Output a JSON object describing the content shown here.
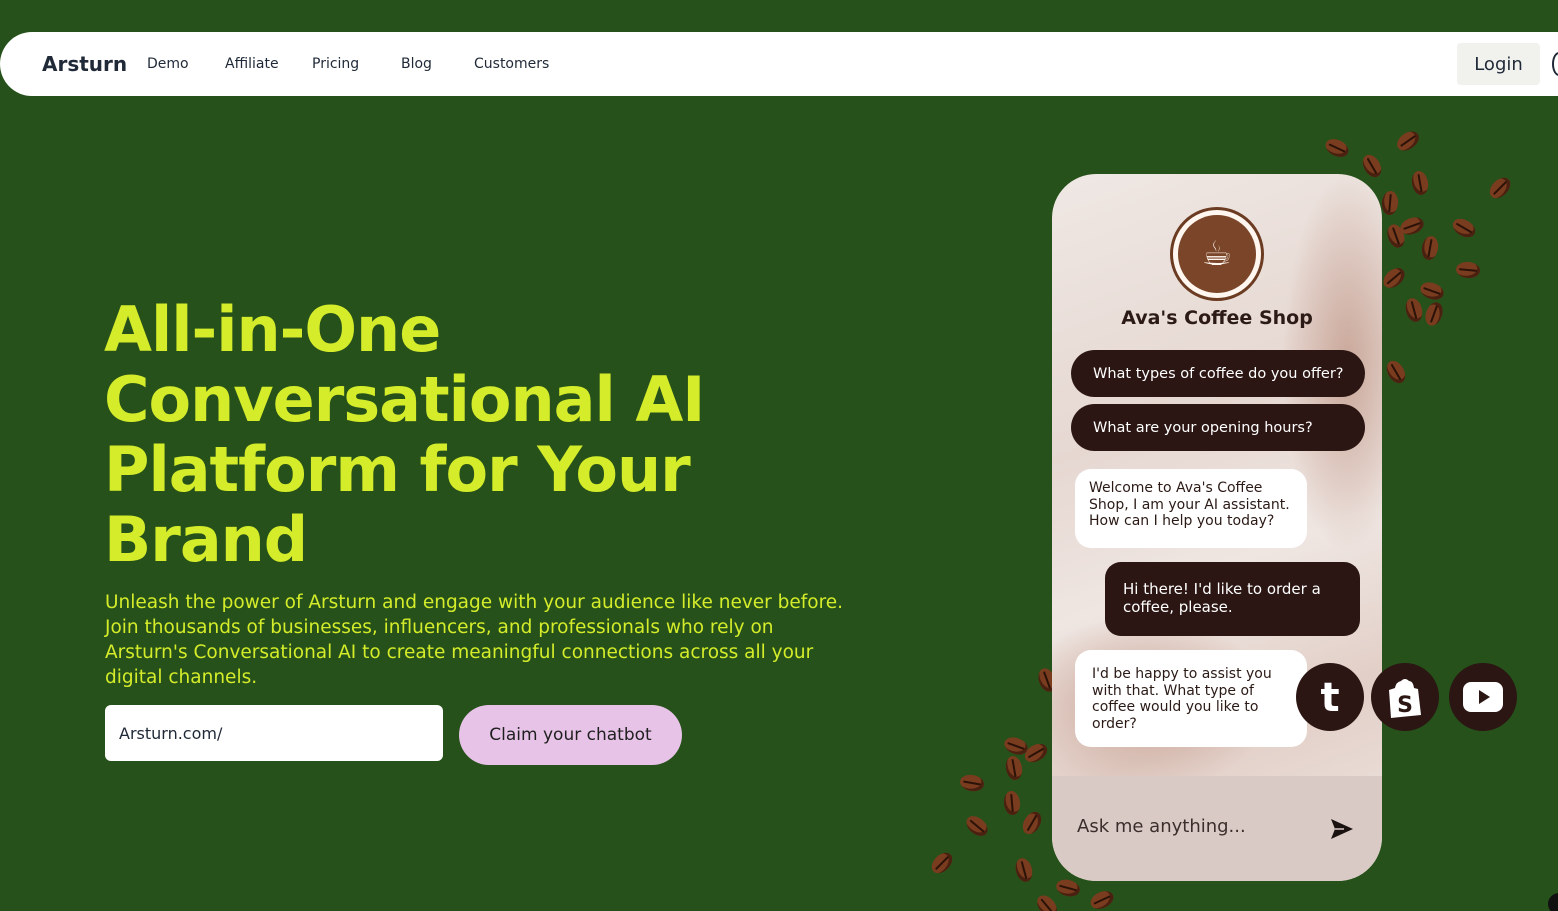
{
  "nav": {
    "brand": "Arsturn",
    "links": [
      "Demo",
      "Affiliate",
      "Pricing",
      "Blog",
      "Customers"
    ],
    "login": "Login"
  },
  "hero": {
    "title": "All-in-One Conversational AI Platform for Your Brand",
    "subtitle": "Unleash the power of Arsturn and engage with your audience like never before. Join thousands of businesses, influencers, and professionals who rely on Arsturn's Conversational AI to create meaningful connections across all your digital channels.",
    "url_value": "Arsturn.com/",
    "cta": "Claim your chatbot"
  },
  "chat": {
    "shop_name": "Ava's Coffee Shop",
    "quick_replies": [
      "What types of coffee do you offer?",
      "What are your opening hours?"
    ],
    "messages": [
      {
        "from": "bot",
        "text": "Welcome to Ava's Coffee Shop, I am your AI assistant. How can I help you today?"
      },
      {
        "from": "user",
        "text": "Hi there! I'd like to order a coffee, please."
      },
      {
        "from": "bot",
        "text": "I'd be happy to assist you with that. What type of coffee would you like to order?"
      }
    ],
    "input_placeholder": "Ask me anything..."
  },
  "social": [
    "tumblr-icon",
    "shopify-icon",
    "youtube-icon"
  ],
  "colors": {
    "background": "#26511a",
    "accent": "#d4ec2a",
    "cta": "#e7c3e8",
    "chat_dark": "#2b1613"
  }
}
